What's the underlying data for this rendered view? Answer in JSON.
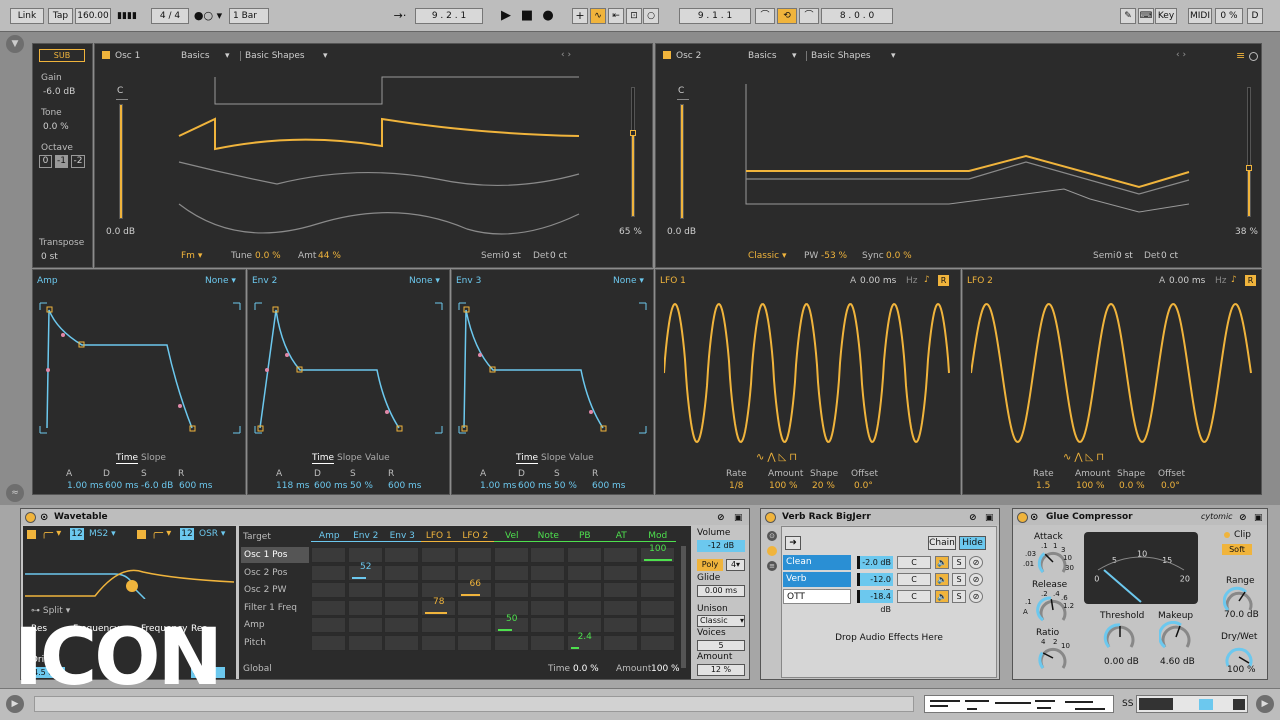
{
  "topbar": {
    "link": "Link",
    "tap": "Tap",
    "tempo": "160.00",
    "sig": "4 / 4",
    "quant": "1 Bar",
    "pos": "9 .   2 .   1",
    "loop_start": "9 .   1 .   1",
    "loop_len": "8 .   0 .   0",
    "key": "Key",
    "midi": "MIDI",
    "cpu": "0 %",
    "d": "D"
  },
  "osc1": {
    "title": "Osc 1",
    "cat": "Basics",
    "preset": "Basic Shapes",
    "pitch": "C",
    "gain_val": "0.0 dB",
    "level": "65 %",
    "mode": "Fm",
    "tune_l": "Tune",
    "tune": "0.0 %",
    "amt_l": "Amt",
    "amt": "44 %",
    "semi_l": "Semi",
    "semi": "0 st",
    "det_l": "Det",
    "det": "0 ct"
  },
  "osc2": {
    "title": "Osc 2",
    "cat": "Basics",
    "preset": "Basic Shapes",
    "pitch": "C",
    "gain_val": "0.0 dB",
    "level": "38 %",
    "mode": "Classic",
    "pw_l": "PW",
    "pw": "-53 %",
    "sync_l": "Sync",
    "sync": "0.0 %",
    "semi_l": "Semi",
    "semi": "0 st",
    "det_l": "Det",
    "det": "0 ct"
  },
  "sub": {
    "label": "SUB",
    "gain_l": "Gain",
    "gain": "-6.0 dB",
    "tone_l": "Tone",
    "tone": "0.0 %",
    "oct_l": "Octave",
    "oct": [
      "0",
      "-1",
      "-2"
    ],
    "tr_l": "Transpose",
    "tr": "0 st"
  },
  "envs": [
    {
      "title": "Amp",
      "target": "None",
      "tabs": [
        "Time",
        "Slope"
      ],
      "A": "1.00 ms",
      "D": "600 ms",
      "S": "-6.0 dB",
      "R": "600 ms"
    },
    {
      "title": "Env 2",
      "target": "None",
      "tabs": [
        "Time",
        "Slope",
        "Value"
      ],
      "A": "118 ms",
      "D": "600 ms",
      "S": "50 %",
      "R": "600 ms"
    },
    {
      "title": "Env 3",
      "target": "None",
      "tabs": [
        "Time",
        "Slope",
        "Value"
      ],
      "A": "1.00 ms",
      "D": "600 ms",
      "S": "50 %",
      "R": "600 ms"
    }
  ],
  "env_letters": [
    "A",
    "D",
    "S",
    "R"
  ],
  "lfo1": {
    "title": "LFO 1",
    "a": "A",
    "a_val": "0.00 ms",
    "hz": "Hz",
    "r": "R",
    "rate_l": "Rate",
    "rate": "1/8",
    "amt_l": "Amount",
    "amt": "100 %",
    "shape_l": "Shape",
    "shape": "20 %",
    "off_l": "Offset",
    "off": "0.0°"
  },
  "lfo2": {
    "title": "LFO 2",
    "a": "A",
    "a_val": "0.00 ms",
    "hz": "Hz",
    "r": "R",
    "rate_l": "Rate",
    "rate": "1.5",
    "amt_l": "Amount",
    "amt": "100 %",
    "shape_l": "Shape",
    "shape": "0.0 %",
    "off_l": "Offset",
    "off": "0.0°"
  },
  "wavetable": {
    "title": "Wavetable",
    "filter1": "MS2",
    "f1n": "12",
    "filter2": "OSR",
    "f2n": "12",
    "split": "Split",
    "res_l": "Res",
    "freq_l": "Frequency",
    "drive_l": "Dri",
    "r1": "4.5 dB",
    "r2": "6.7"
  },
  "matrix": {
    "target_l": "Target",
    "cols": [
      "Amp",
      "Env 2",
      "Env 3",
      "LFO 1",
      "LFO 2",
      "Vel",
      "Note",
      "PB",
      "AT",
      "Mod"
    ],
    "rows": [
      "Osc 1 Pos",
      "Osc 2 Pos",
      "Osc 2 PW",
      "Filter 1 Freq",
      "Amp",
      "Pitch"
    ],
    "global": "Global",
    "time_l": "Time",
    "time": "0.0 %",
    "amount_l": "Amount",
    "amount": "100 %",
    "cells": {
      "v1": "100",
      "v2": "52",
      "v3": "66",
      "v4": "78",
      "v5": "50",
      "v6": "2.4"
    }
  },
  "voice": {
    "vol_l": "Volume",
    "vol": "-12 dB",
    "poly": "Poly",
    "voices_n": "4",
    "glide_l": "Glide",
    "glide": "0.00 ms",
    "unison_l": "Unison",
    "unison": "Classic",
    "voices_l": "Voices",
    "voices": "5",
    "amount_l": "Amount",
    "amount": "12 %"
  },
  "rack": {
    "title": "Verb Rack BigJerr",
    "chain": "Chain",
    "hide": "Hide",
    "chains": [
      {
        "name": "Clean",
        "vol": "-2.0 dB",
        "pan": "C"
      },
      {
        "name": "Verb",
        "vol": "-12.0 dB",
        "pan": "C"
      },
      {
        "name": "OTT",
        "vol": "-18.4 dB",
        "pan": "C"
      }
    ],
    "drop": "Drop Audio Effects Here",
    "s": "S"
  },
  "glue": {
    "title": "Glue Compressor",
    "brand": "cytomic",
    "attack_l": "Attack",
    "release_l": "Release",
    "ratio_l": "Ratio",
    "clip_l": "Clip",
    "soft": "Soft",
    "threshold_l": "Threshold",
    "threshold": "0.00 dB",
    "makeup_l": "Makeup",
    "makeup": "4.60 dB",
    "range_l": "Range",
    "range": "70.0 dB",
    "drywet_l": "Dry/Wet",
    "drywet": "100 %",
    "meter": [
      "0",
      "5",
      "10",
      "15",
      "20"
    ],
    "atk_ticks": [
      ".1",
      "1",
      "3",
      ".03",
      "10",
      ".01",
      "30"
    ],
    "rel_ticks": [
      ".2",
      ".4",
      ".6",
      ".1",
      "1.2",
      "A"
    ],
    "ratio_ticks": [
      "4",
      "2",
      "10"
    ]
  },
  "bottom": {
    "ss": "SS"
  },
  "watermark": "ICON"
}
